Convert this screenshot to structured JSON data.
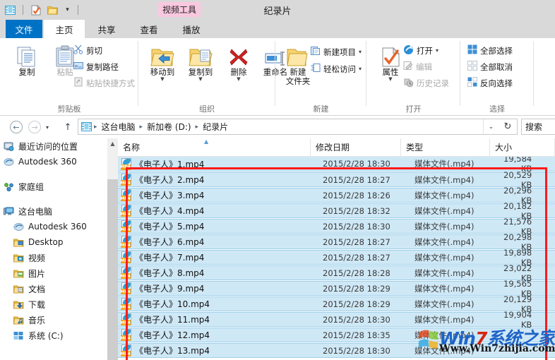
{
  "window": {
    "title": "纪录片",
    "contextual_tab_label": "视频工具"
  },
  "quick_access": {
    "items": [
      {
        "name": "video-folder-icon",
        "label": "视频工具"
      },
      {
        "name": "properties-icon",
        "label": "属性"
      },
      {
        "name": "new-folder-icon",
        "label": "新建文件夹"
      },
      {
        "name": "customize-caret",
        "label": "▾"
      }
    ]
  },
  "tabs": [
    {
      "label": "文件",
      "active": false,
      "file": true
    },
    {
      "label": "主页",
      "active": true
    },
    {
      "label": "共享",
      "active": false
    },
    {
      "label": "查看",
      "active": false
    },
    {
      "label": "播放",
      "active": false
    }
  ],
  "ribbon": {
    "groups": [
      {
        "title": "剪贴板",
        "big": [
          {
            "label": "复制",
            "icon": "copy-icon",
            "disabled": false
          },
          {
            "label": "粘贴",
            "icon": "paste-icon",
            "disabled": true
          }
        ],
        "small": [
          {
            "label": "剪切",
            "icon": "scissors-icon",
            "disabled": false
          },
          {
            "label": "复制路径",
            "icon": "copy-path-icon",
            "disabled": false
          },
          {
            "label": "粘贴快捷方式",
            "icon": "paste-shortcut-icon",
            "disabled": true
          }
        ]
      },
      {
        "title": "组织",
        "big": [
          {
            "label": "移动到",
            "icon": "move-to-icon",
            "caret": true
          },
          {
            "label": "复制到",
            "icon": "copy-to-icon",
            "caret": true
          },
          {
            "label": "删除",
            "icon": "delete-icon",
            "caret": true
          },
          {
            "label": "重命名",
            "icon": "rename-icon",
            "caret": false
          }
        ]
      },
      {
        "title": "新建",
        "big": [
          {
            "label": "新建\n文件夹",
            "label_line1": "新建",
            "label_line2": "文件夹",
            "icon": "new-folder-icon"
          }
        ],
        "small": [
          {
            "label": "新建项目",
            "icon": "new-item-icon",
            "caret": true
          },
          {
            "label": "轻松访问",
            "icon": "easy-access-icon",
            "caret": true
          }
        ]
      },
      {
        "title": "打开",
        "big": [
          {
            "label": "属性",
            "icon": "properties-icon",
            "caret": true
          }
        ],
        "small": [
          {
            "label": "打开",
            "icon": "open-icon",
            "caret": true,
            "disabled": false
          },
          {
            "label": "编辑",
            "icon": "edit-icon",
            "disabled": true
          },
          {
            "label": "历史记录",
            "icon": "history-icon",
            "disabled": true
          }
        ]
      },
      {
        "title": "选择",
        "small": [
          {
            "label": "全部选择",
            "icon": "select-all-icon"
          },
          {
            "label": "全部取消",
            "icon": "select-none-icon"
          },
          {
            "label": "反向选择",
            "icon": "invert-selection-icon"
          }
        ]
      }
    ]
  },
  "address_bar": {
    "back_label": "←",
    "forward_label": "→",
    "recent_caret": "▾",
    "up_label": "↑",
    "breadcrumb": [
      "这台电脑",
      "新加卷 (D:)",
      "纪录片"
    ],
    "separator": "▸",
    "dropdown_label": "⌄",
    "refresh_label": "↻",
    "search_placeholder": "搜索"
  },
  "nav_pane": {
    "items": [
      {
        "label": "最近访问的位置",
        "icon": "recent-places-icon",
        "indent": false
      },
      {
        "label": "Autodesk 360",
        "icon": "autodesk-icon",
        "indent": false
      },
      {
        "spacer": true
      },
      {
        "label": "家庭组",
        "icon": "homegroup-icon",
        "indent": false
      },
      {
        "spacer": true
      },
      {
        "label": "这台电脑",
        "icon": "this-pc-icon",
        "indent": false
      },
      {
        "label": "Autodesk 360",
        "icon": "autodesk-icon",
        "indent": true
      },
      {
        "label": "Desktop",
        "icon": "desktop-folder-icon",
        "indent": true
      },
      {
        "label": "视频",
        "icon": "videos-folder-icon",
        "indent": true
      },
      {
        "label": "图片",
        "icon": "pictures-folder-icon",
        "indent": true
      },
      {
        "label": "文档",
        "icon": "documents-folder-icon",
        "indent": true
      },
      {
        "label": "下载",
        "icon": "downloads-folder-icon",
        "indent": true
      },
      {
        "label": "音乐",
        "icon": "music-folder-icon",
        "indent": true
      },
      {
        "label": "系统 (C:)",
        "icon": "drive-icon",
        "indent": true
      }
    ]
  },
  "file_list": {
    "columns": [
      {
        "label": "名称",
        "sorted": true,
        "sort_dir": "asc"
      },
      {
        "label": "修改日期"
      },
      {
        "label": "类型"
      },
      {
        "label": "大小"
      }
    ],
    "rows": [
      {
        "name": "《电子人》1.mp4",
        "date": "2015/2/28 18:30",
        "type": "媒体文件(.mp4)",
        "size": "19,584 KB",
        "selected": true
      },
      {
        "name": "《电子人》2.mp4",
        "date": "2015/2/28 18:27",
        "type": "媒体文件(.mp4)",
        "size": "20,529 KB",
        "selected": true
      },
      {
        "name": "《电子人》3.mp4",
        "date": "2015/2/28 18:26",
        "type": "媒体文件(.mp4)",
        "size": "20,296 KB",
        "selected": true
      },
      {
        "name": "《电子人》4.mp4",
        "date": "2015/2/28 18:32",
        "type": "媒体文件(.mp4)",
        "size": "20,182 KB",
        "selected": true
      },
      {
        "name": "《电子人》5.mp4",
        "date": "2015/2/28 18:30",
        "type": "媒体文件(.mp4)",
        "size": "21,576 KB",
        "selected": true
      },
      {
        "name": "《电子人》6.mp4",
        "date": "2015/2/28 18:27",
        "type": "媒体文件(.mp4)",
        "size": "20,298 KB",
        "selected": true
      },
      {
        "name": "《电子人》7.mp4",
        "date": "2015/2/28 18:27",
        "type": "媒体文件(.mp4)",
        "size": "19,898 KB",
        "selected": true
      },
      {
        "name": "《电子人》8.mp4",
        "date": "2015/2/28 18:28",
        "type": "媒体文件(.mp4)",
        "size": "23,022 KB",
        "selected": true
      },
      {
        "name": "《电子人》9.mp4",
        "date": "2015/2/28 18:29",
        "type": "媒体文件(.mp4)",
        "size": "19,565 KB",
        "selected": true
      },
      {
        "name": "《电子人》10.mp4",
        "date": "2015/2/28 18:29",
        "type": "媒体文件(.mp4)",
        "size": "20,129 KB",
        "selected": true
      },
      {
        "name": "《电子人》11.mp4",
        "date": "2015/2/28 18:30",
        "type": "媒体文件(.mp4)",
        "size": "19,904 KB",
        "selected": true
      },
      {
        "name": "《电子人》12.mp4",
        "date": "2015/2/28 18:35",
        "type": "媒体文件(.mp4)",
        "size": "",
        "selected": true
      },
      {
        "name": "《电子人》13.mp4",
        "date": "2015/2/28 18:30",
        "type": "媒体文件(.mp4)",
        "size": "",
        "selected": true
      }
    ]
  },
  "annotation": {
    "highlight_color": "#fb1b1b"
  },
  "watermark": {
    "main_prefix": "Win",
    "main_digit": "7",
    "main_suffix": "系统之家",
    "sub": "Www.Win7zhijia.com"
  }
}
